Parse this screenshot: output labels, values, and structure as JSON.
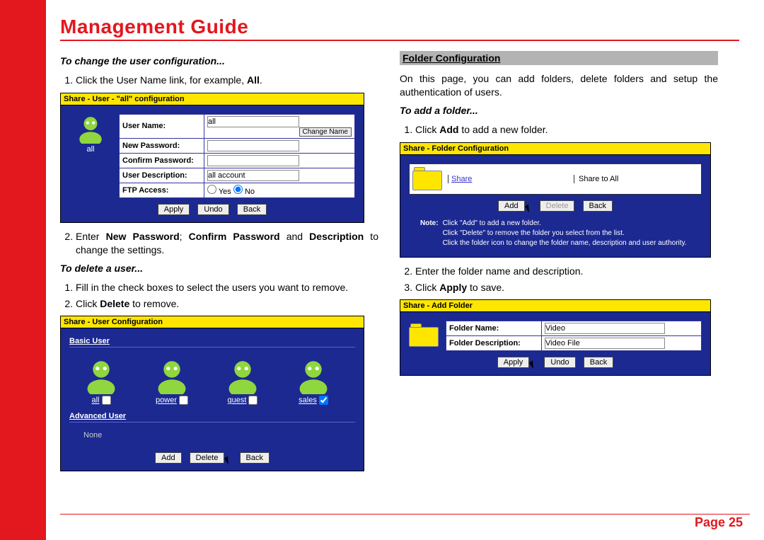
{
  "title": "Management Guide",
  "page_label": "Page 25",
  "left": {
    "h1": "To change the user configuration...",
    "step1_pre": "Click the User Name link, for example, ",
    "step1_bold": "All",
    "step1_post": ".",
    "panel1": {
      "title": "Share - User - \"all\" configuration",
      "avatar_label": "all",
      "change_name": "Change Name",
      "rows": {
        "username_label": "User Name:",
        "username_value": "all",
        "newpass_label": "New Password:",
        "confirmpass_label": "Confirm Password:",
        "userdesc_label": "User Description:",
        "userdesc_value": "all account",
        "ftp_label": "FTP Access:",
        "ftp_yes": "Yes",
        "ftp_no": "No"
      },
      "buttons": {
        "apply": "Apply",
        "undo": "Undo",
        "back": "Back"
      }
    },
    "step2_pre": "Enter ",
    "step2_b1": "New Password",
    "step2_sep": "; ",
    "step2_b2": "Confirm Password",
    "step2_mid": " and ",
    "step2_b3": "Description",
    "step2_post": " to change the settings.",
    "h2": "To delete a user...",
    "del_step1": "Fill in the check boxes to select the users you want to remove.",
    "del_step2_pre": "Click ",
    "del_step2_bold": "Delete",
    "del_step2_post": " to remove.",
    "panel2": {
      "title": "Share - User Configuration",
      "basic": "Basic User",
      "advanced": "Advanced User",
      "none": "None",
      "users": [
        {
          "name": "all",
          "checked": false
        },
        {
          "name": "power",
          "checked": false
        },
        {
          "name": "guest",
          "checked": false
        },
        {
          "name": "sales",
          "checked": true
        }
      ],
      "buttons": {
        "add": "Add",
        "delete": "Delete",
        "back": "Back"
      }
    }
  },
  "right": {
    "band": "Folder Configuration",
    "intro": "On this page, you can add folders, delete folders and setup the authentication of users.",
    "h1": "To add a folder...",
    "step1_pre": "Click ",
    "step1_bold": "Add",
    "step1_post": " to add a new folder.",
    "panel3": {
      "title": "Share - Folder Configuration",
      "share_link": "Share",
      "share_desc": "Share to All",
      "buttons": {
        "add": "Add",
        "delete": "Delete",
        "back": "Back"
      },
      "note_label": "Note:",
      "note_l1": "Click \"Add\" to add a new folder.",
      "note_l2": "Click \"Delete\" to remove the folder you select from the list.",
      "note_l3": "Click the folder icon to change the folder name, description and user authority."
    },
    "step2": "Enter the folder name and description.",
    "step3_pre": "Click ",
    "step3_bold": "Apply",
    "step3_post": " to save.",
    "panel4": {
      "title": "Share - Add Folder",
      "name_label": "Folder Name:",
      "name_value": "Video",
      "desc_label": "Folder Description:",
      "desc_value": "Video File",
      "buttons": {
        "apply": "Apply",
        "undo": "Undo",
        "back": "Back"
      }
    }
  }
}
